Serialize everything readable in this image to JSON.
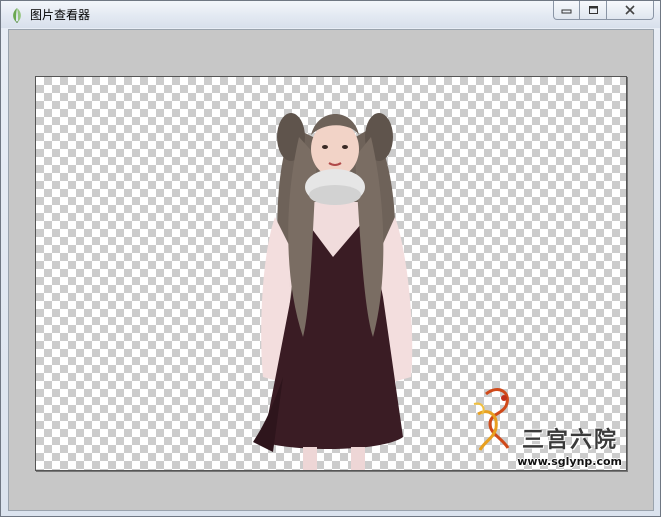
{
  "window": {
    "title": "图片查看器",
    "icon": "leaf-app-icon"
  },
  "caption_buttons": {
    "minimize": "minimize-icon",
    "maximize": "maximize-icon",
    "close": "close-icon"
  },
  "viewer": {
    "background": "transparent-checkerboard",
    "image_subject": "sims-character-girl-pigtails-dark-dress"
  },
  "watermark": {
    "text": "三宫六院",
    "url": "www.sglynp.com"
  },
  "colors": {
    "client_bg": "#c7c7c7",
    "titlebar_top": "#f3f6fb",
    "titlebar_bottom": "#d8e0ec"
  }
}
